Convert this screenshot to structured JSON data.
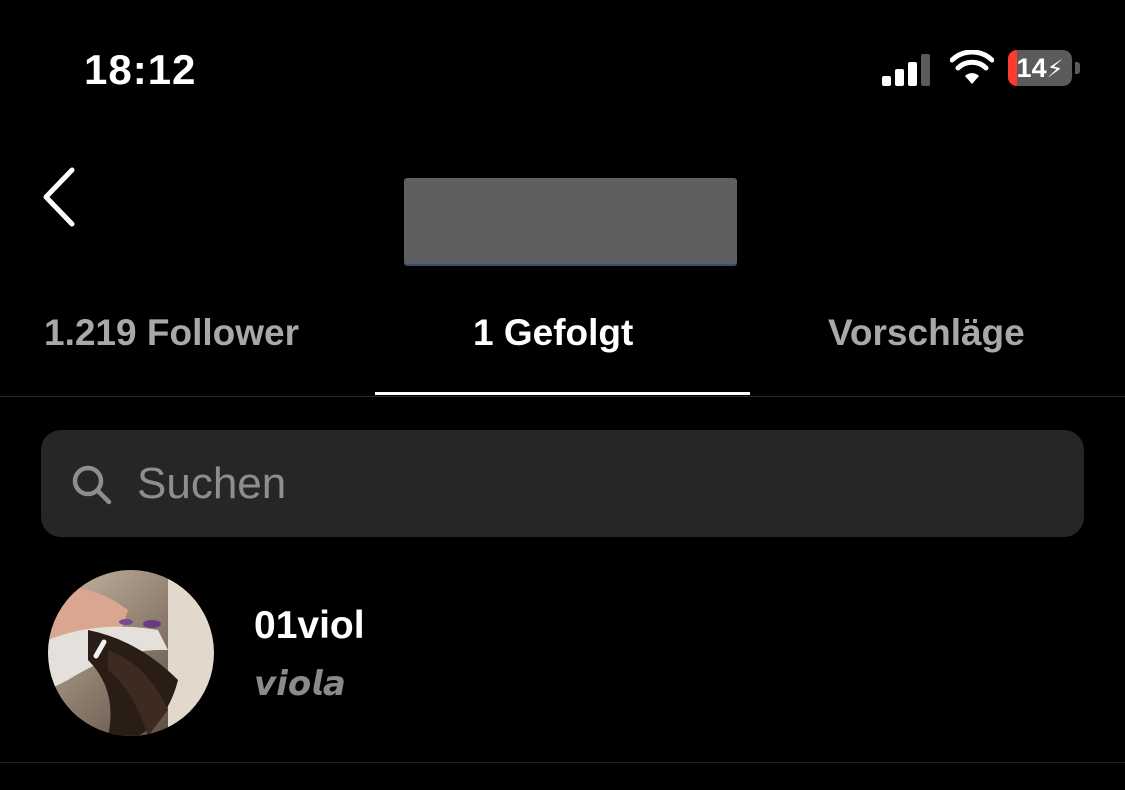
{
  "status_bar": {
    "time": "18:12",
    "battery_level": "14",
    "battery_percent": 14,
    "battery_charging": true,
    "signal_bars": 3,
    "signal_bars_total": 4
  },
  "header": {
    "back_icon": "chevron-left-icon",
    "title_redacted": true
  },
  "tabs": [
    {
      "label": "1.219 Follower",
      "active": false
    },
    {
      "label": "1 Gefolgt",
      "active": true
    },
    {
      "label": "Vorschläge",
      "active": false
    }
  ],
  "search": {
    "icon": "search-icon",
    "placeholder": "Suchen"
  },
  "following_list": [
    {
      "username": "01viol",
      "full_name": "𝙫𝙞𝙤𝙡𝙖",
      "avatar": "profile-photo"
    }
  ],
  "colors": {
    "background": "#000000",
    "text_primary": "#ffffff",
    "text_secondary": "#a8a8a8",
    "search_bg": "#262626",
    "battery_low": "#ff3b30"
  }
}
